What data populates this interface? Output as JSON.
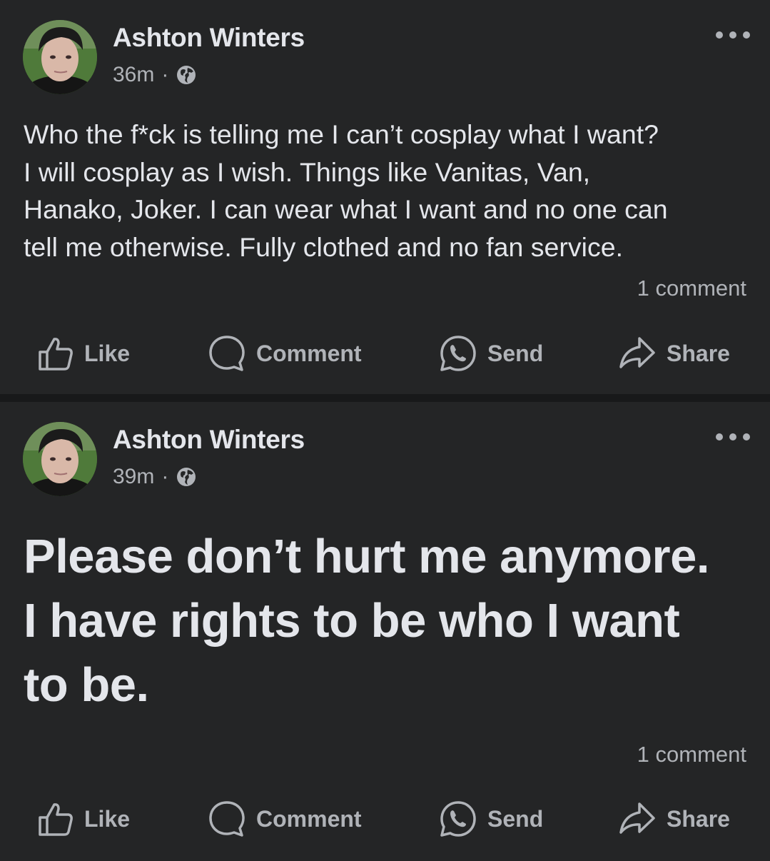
{
  "posts": [
    {
      "author": "Ashton Winters",
      "time": "36m",
      "separator": "·",
      "privacy_icon": "globe-icon",
      "text": "Who the f*ck is telling me I can’t cosplay what I want?\nI will cosplay as I wish.  Things like Vanitas, Van,\nHanako, Joker. I can wear what I want and no one can\ntell me otherwise.  Fully clothed and no fan service.",
      "comment_count": "1 comment",
      "actions": {
        "like": "Like",
        "comment": "Comment",
        "send": "Send",
        "share": "Share"
      }
    },
    {
      "author": "Ashton Winters",
      "time": "39m",
      "separator": "·",
      "privacy_icon": "globe-icon",
      "text": "Please don’t hurt me anymore.\nI have rights to be who I want\nto be.",
      "comment_count": "1 comment",
      "actions": {
        "like": "Like",
        "comment": "Comment",
        "send": "Send",
        "share": "Share"
      }
    }
  ],
  "colors": {
    "page_background": "#18191a",
    "card_background": "#242526",
    "primary_text": "#e4e6eb",
    "secondary_text": "#b0b3b8"
  }
}
